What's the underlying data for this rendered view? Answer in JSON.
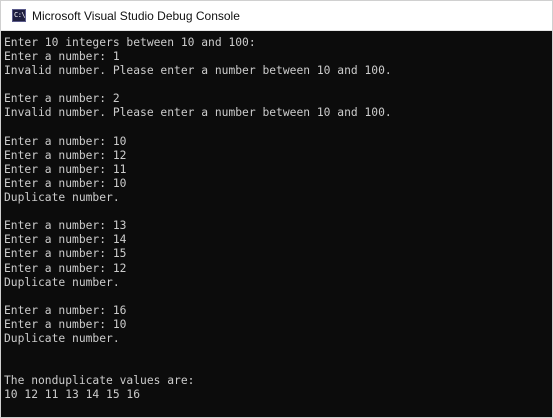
{
  "window": {
    "title": "Microsoft Visual Studio Debug Console",
    "icon": "console-app-icon",
    "icon_glyph": "C:\\"
  },
  "colors": {
    "console_background": "#0c0c0c",
    "console_text": "#cccccc",
    "titlebar_background": "#ffffff"
  },
  "console": {
    "lines": [
      "Enter 10 integers between 10 and 100:",
      "Enter a number: 1",
      "Invalid number. Please enter a number between 10 and 100.",
      "",
      "Enter a number: 2",
      "Invalid number. Please enter a number between 10 and 100.",
      "",
      "Enter a number: 10",
      "Enter a number: 12",
      "Enter a number: 11",
      "Enter a number: 10",
      "Duplicate number.",
      "",
      "Enter a number: 13",
      "Enter a number: 14",
      "Enter a number: 15",
      "Enter a number: 12",
      "Duplicate number.",
      "",
      "Enter a number: 16",
      "Enter a number: 10",
      "Duplicate number.",
      "",
      "",
      "The nonduplicate values are:",
      "10 12 11 13 14 15 16"
    ]
  }
}
